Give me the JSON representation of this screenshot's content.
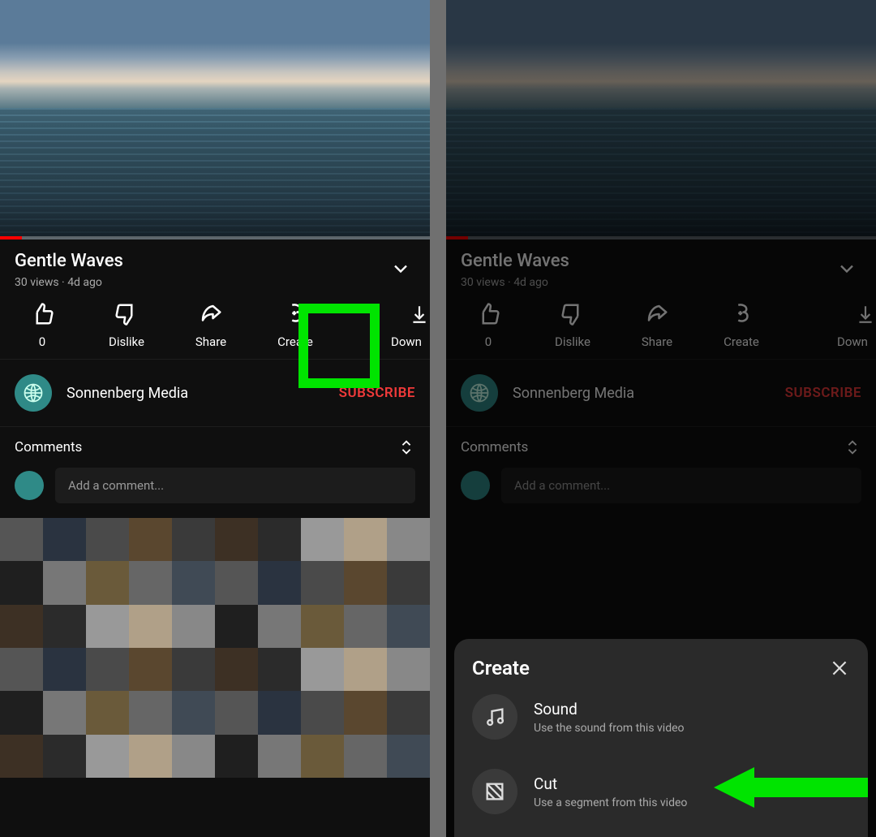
{
  "video": {
    "title": "Gentle Waves",
    "views": "30 views",
    "age": "4d ago",
    "subtitle_sep": " · "
  },
  "actions": {
    "like_count": "0",
    "dislike": "Dislike",
    "share": "Share",
    "create": "Create",
    "download": "Down"
  },
  "channel": {
    "name": "Sonnenberg Media",
    "subscribe": "SUBSCRIBE"
  },
  "comments": {
    "heading": "Comments",
    "placeholder": "Add a comment..."
  },
  "sheet": {
    "title": "Create",
    "items": [
      {
        "title": "Sound",
        "subtitle": "Use the sound from this video"
      },
      {
        "title": "Cut",
        "subtitle": "Use a segment from this video"
      }
    ]
  },
  "annotations": {
    "highlight_target": "create-action",
    "arrow_target": "cut-option",
    "annotation_color": "#00e400"
  }
}
